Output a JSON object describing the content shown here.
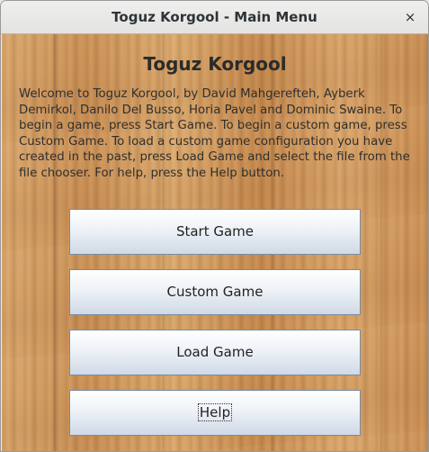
{
  "window": {
    "title": "Toguz Korgool - Main Menu",
    "close_symbol": "×"
  },
  "main": {
    "heading": "Toguz Korgool",
    "welcome_text": "Welcome to Toguz Korgool, by David Mahgerefteh, Ayberk Demirkol, Danilo Del Busso, Horia Pavel and Dominic Swaine. To begin a game, press Start Game. To begin a custom game, press Custom Game. To load a custom game configuration you have created in the past, press Load Game and select the file from the file chooser. For help, press the Help button."
  },
  "buttons": {
    "start": "Start Game",
    "custom": "Custom Game",
    "load": "Load Game",
    "help": "Help"
  }
}
